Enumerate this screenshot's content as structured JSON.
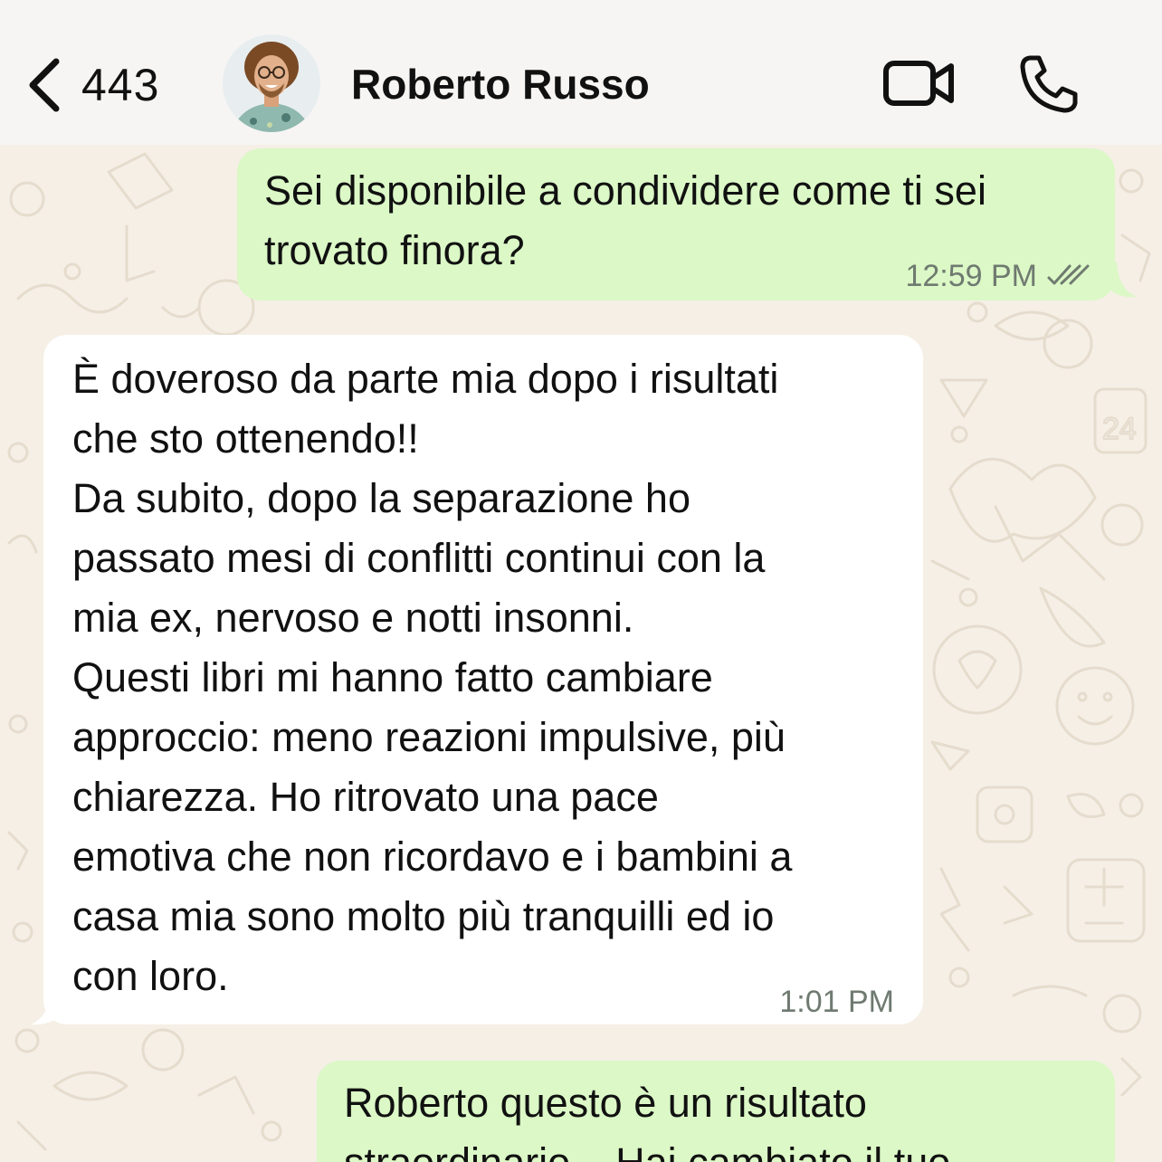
{
  "header": {
    "back_count": "443",
    "contact_name": "Roberto Russo"
  },
  "messages": [
    {
      "direction": "outgoing",
      "text": "Sei disponibile a condividere come ti sei\ntrovato finora?",
      "time": "12:59 PM",
      "status": "read-double-check-icon"
    },
    {
      "direction": "incoming",
      "text": "È doveroso da parte mia dopo i risultati\nche sto ottenendo!!\nDa subito, dopo la separazione ho\npassato mesi di conflitti continui con la\nmia ex, nervoso e notti insonni.\nQuesti libri mi hanno fatto cambiare\napproccio: meno reazioni impulsive, più\nchiarezza. Ho ritrovato una pace\nemotiva che non ricordavo e i bambini a\ncasa mia sono molto più tranquilli ed io\ncon loro.",
      "time": "1:01 PM"
    },
    {
      "direction": "outgoing",
      "text": "Roberto questo è un risultato\nstraordinario... Hai cambiato il tuo"
    }
  ],
  "colors": {
    "wallpaper": "#f5efe6",
    "header": "#f6f5f3",
    "outgoing_bubble": "#dbf8c6",
    "incoming_bubble": "#ffffff",
    "meta_text": "#6f7a70",
    "read_check": "#6f7a70"
  },
  "icons": [
    "chevron-left-icon",
    "video-call-icon",
    "phone-icon",
    "read-double-check-icon"
  ]
}
